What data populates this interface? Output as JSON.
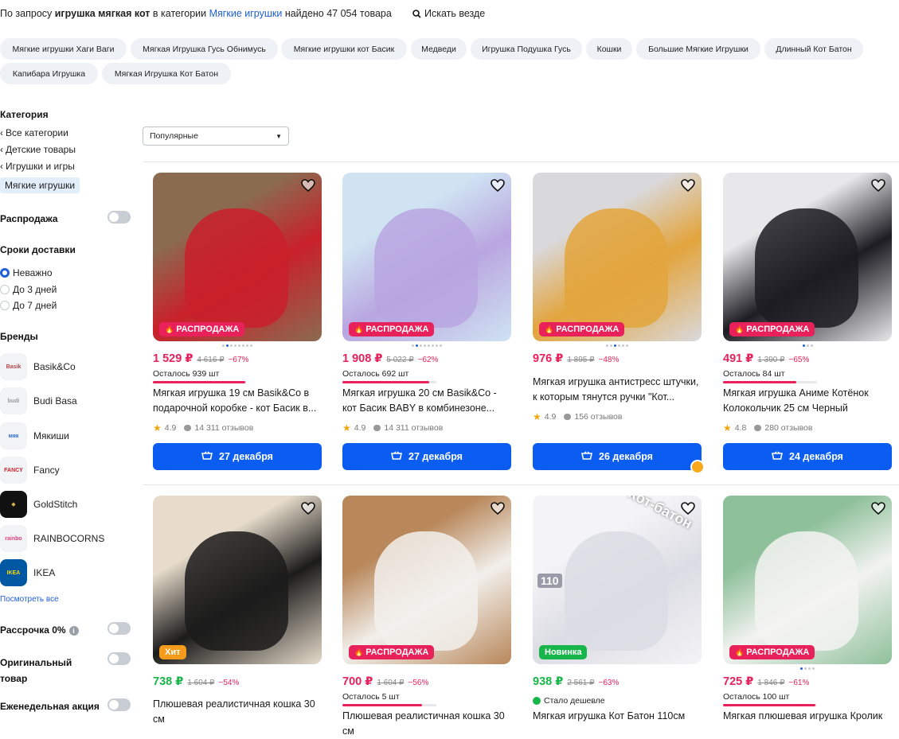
{
  "header": {
    "prefix": "По запросу",
    "query": "игрушка мягкая кот",
    "middle": "в категории",
    "category": "Мягкие игрушки",
    "found": "найдено 47 054 товара",
    "search_everywhere": "Искать везде"
  },
  "chips": [
    {
      "label": "Мягкие игрушки Хаги Ваги"
    },
    {
      "label": "Мягкая Игрушка Гусь Обнимусь"
    },
    {
      "label": "Мягкие игрушки кот Басик"
    },
    {
      "label": "Медведи"
    },
    {
      "label": "Игрушка Подушка Гусь"
    },
    {
      "label": "Кошки"
    },
    {
      "label": "Большие Мягкие Игрушки"
    },
    {
      "label": "Длинный Кот Батон"
    },
    {
      "label": "Капибара Игрушка"
    },
    {
      "label": "Мягкая Игрушка Кот Батон"
    }
  ],
  "sidebar": {
    "category_title": "Категория",
    "links": [
      "Все категории",
      "Детские товары",
      "Игрушки и игры"
    ],
    "active": "Мягкие игрушки",
    "sale": "Распродажа",
    "delivery_title": "Сроки доставки",
    "delivery_options": [
      "Неважно",
      "До 3 дней",
      "До 7 дней"
    ],
    "brands_title": "Бренды",
    "brands": [
      "Basik&Co",
      "Budi Basa",
      "Мякиши",
      "Fancy",
      "GoldStitch",
      "RAINBOCORNS",
      "IKEA"
    ],
    "see_all": "Посмотреть все",
    "installment": "Рассрочка 0%",
    "original": "Оригинальный товар",
    "weekly": "Еженедельная акция"
  },
  "sort": {
    "value": "Популярные"
  },
  "products": [
    {
      "badge": "РАСПРОДАЖА",
      "badge_type": "sale",
      "price": "1 529 ₽",
      "old": "4 616 ₽",
      "discount": "−67%",
      "stock": "Осталось 939 шт",
      "stock_level": 0.98,
      "title": "Мягкая игрушка 19 см Basik&Co в подарочной коробке - кот Басик в...",
      "rating": "4.9",
      "reviews": "14 311 отзывов",
      "delivery": "27 декабря",
      "colors": [
        "#c9202a",
        "#8b6b50"
      ]
    },
    {
      "badge": "РАСПРОДАЖА",
      "badge_type": "sale",
      "price": "1 908 ₽",
      "old": "5 022 ₽",
      "discount": "−62%",
      "stock": "Осталось 692 шт",
      "stock_level": 0.92,
      "title": "Мягкая игрушка 20 см Basik&Co - кот Басик BABY в комбинезоне...",
      "rating": "4.9",
      "reviews": "14 311 отзывов",
      "delivery": "27 декабря",
      "colors": [
        "#b9a6e0",
        "#cfe3f2"
      ]
    },
    {
      "badge": "РАСПРОДАЖА",
      "badge_type": "sale",
      "price": "976 ₽",
      "old": "1 895 ₽",
      "discount": "−48%",
      "stock": "",
      "stock_level": 0,
      "title": "Мягкая игрушка антистресс штучки, к которым тянутся ручки \"Кот...",
      "rating": "4.9",
      "reviews": "156 отзывов",
      "delivery": "26 декабря",
      "colors": [
        "#e3a43c",
        "#d9d9dc"
      ]
    },
    {
      "badge": "РАСПРОДАЖА",
      "badge_type": "sale",
      "price": "491 ₽",
      "old": "1 390 ₽",
      "discount": "−65%",
      "stock": "Осталось 84 шт",
      "stock_level": 0.78,
      "title": "Мягкая игрушка Аниме Котёнок Колокольчик 25 см Черный",
      "rating": "4.8",
      "reviews": "280 отзывов",
      "delivery": "24 декабря",
      "colors": [
        "#1c1c22",
        "#e8e8ea"
      ]
    },
    {
      "badge": "Хит",
      "badge_type": "hit",
      "price": "738 ₽",
      "price_green": true,
      "old": "1 604 ₽",
      "discount": "−54%",
      "title": "Плюшевая реалистичная кошка 30 см",
      "colors": [
        "#1b1b1b",
        "#e7dccb"
      ]
    },
    {
      "badge": "РАСПРОДАЖА",
      "badge_type": "sale",
      "price": "700 ₽",
      "old": "1 604 ₽",
      "discount": "−56%",
      "stock": "Осталось 5 шт",
      "stock_level": 0.85,
      "title": "Плюшевая реалистичная кошка 30 см",
      "colors": [
        "#f2f0ec",
        "#b8875a"
      ]
    },
    {
      "badge": "Новинка",
      "badge_type": "new",
      "price": "938 ₽",
      "price_green": true,
      "old": "2 561 ₽",
      "discount": "−63%",
      "cheaper": "Стало дешевле",
      "title": "Мягкая игрушка Кот Батон 110см",
      "overlay": "Кот-батон",
      "size": "110",
      "colors": [
        "#dcdce4",
        "#f4f4f6"
      ]
    },
    {
      "badge": "РАСПРОДАЖА",
      "badge_type": "sale",
      "price": "725 ₽",
      "old": "1 846 ₽",
      "discount": "−61%",
      "stock": "Осталось 100 шт",
      "stock_level": 0.98,
      "title": "Мягкая плюшевая игрушка Кролик",
      "colors": [
        "#f3f3f1",
        "#8ec09a"
      ]
    }
  ]
}
